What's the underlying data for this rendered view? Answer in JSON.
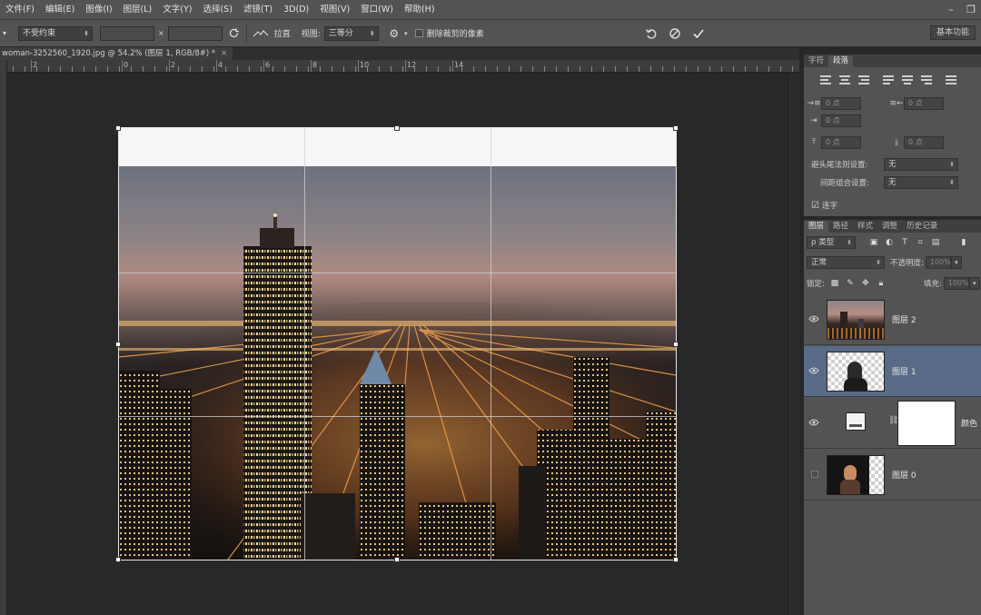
{
  "menu": [
    "文件(F)",
    "编辑(E)",
    "图像(I)",
    "图层(L)",
    "文字(Y)",
    "选择(S)",
    "滤镜(T)",
    "3D(D)",
    "视图(V)",
    "窗口(W)",
    "帮助(H)"
  ],
  "window_buttons": {
    "minimize": "–",
    "restore": "❐"
  },
  "options": {
    "ratio": "不受约束",
    "width_value": "",
    "times": "×",
    "height_value": "",
    "straighten": "拉直",
    "view_label": "视图:",
    "view_value": "三等分",
    "delete_cropped": "删除裁剪的像素",
    "workspace": "基本功能"
  },
  "document": {
    "tab_title": "woman-3252560_1920.jpg @ 54.2% (图层 1, RGB/8#) *",
    "close": "×"
  },
  "ruler": {
    "labels": [
      "2",
      "0",
      "2",
      "4",
      "6",
      "8",
      "10",
      "12",
      "14"
    ]
  },
  "paragraph_panel": {
    "tabs": [
      "字符",
      "段落"
    ],
    "active_tab": 1,
    "zero_pt": "0 点",
    "kinsoku_label": "避头尾法则设置:",
    "kinsoku_value": "无",
    "mojikumi_label": "间距组合设置:",
    "mojikumi_value": "无",
    "hyphenate_label": "连字"
  },
  "layers_panel": {
    "tabs": [
      "图层",
      "路径",
      "样式",
      "调整",
      "历史记录"
    ],
    "active_tab": 0,
    "filter_label": "ρ 类型",
    "blend_mode": "正常",
    "opacity_label": "不透明度:",
    "opacity_value": "100%",
    "lock_label": "锁定:",
    "fill_label": "填充:",
    "fill_value": "100%",
    "layers": [
      {
        "name": "图层 2",
        "visible": true,
        "selected": false
      },
      {
        "name": "图层 1",
        "visible": true,
        "selected": true
      },
      {
        "name": "颜色",
        "visible": true,
        "selected": false
      },
      {
        "name": "图层 0",
        "visible": false,
        "selected": false
      }
    ]
  },
  "colors": {
    "ui_panel": "#535353",
    "selection_highlight": "#596a86",
    "canvas_bg": "#282828"
  }
}
